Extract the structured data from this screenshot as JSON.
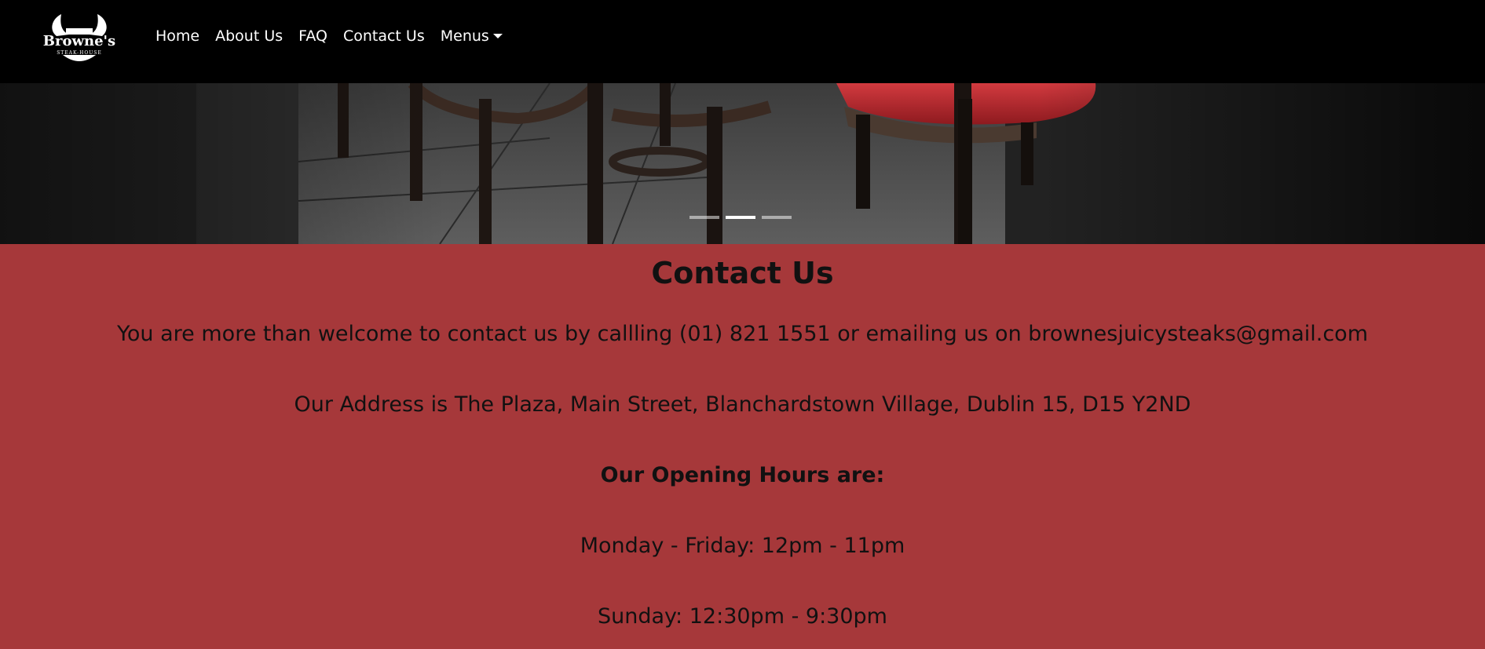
{
  "brand": {
    "name": "Browne's",
    "tagline": "STEAK-HOUSE"
  },
  "nav": {
    "items": [
      {
        "label": "Home"
      },
      {
        "label": "About Us"
      },
      {
        "label": "FAQ"
      },
      {
        "label": "Contact Us"
      },
      {
        "label": "Menus"
      }
    ]
  },
  "carousel": {
    "slides": 3,
    "active_slide": 2
  },
  "contact": {
    "title": "Contact Us",
    "intro": "You are more than welcome to contact us by callling (01) 821 1551 or emailing us on brownesjuicysteaks@gmail.com",
    "address": "Our Address is The Plaza, Main Street, Blanchardstown Village, Dublin 15, D15 Y2ND",
    "hours_heading": "Our Opening Hours are:",
    "weekday_hours": "Monday - Friday: 12pm - 11pm",
    "sunday_hours": "Sunday: 12:30pm - 9:30pm"
  },
  "colors": {
    "navbar": "#000000",
    "content_bg": "#a6383a",
    "chair_red": "#b3242a"
  }
}
